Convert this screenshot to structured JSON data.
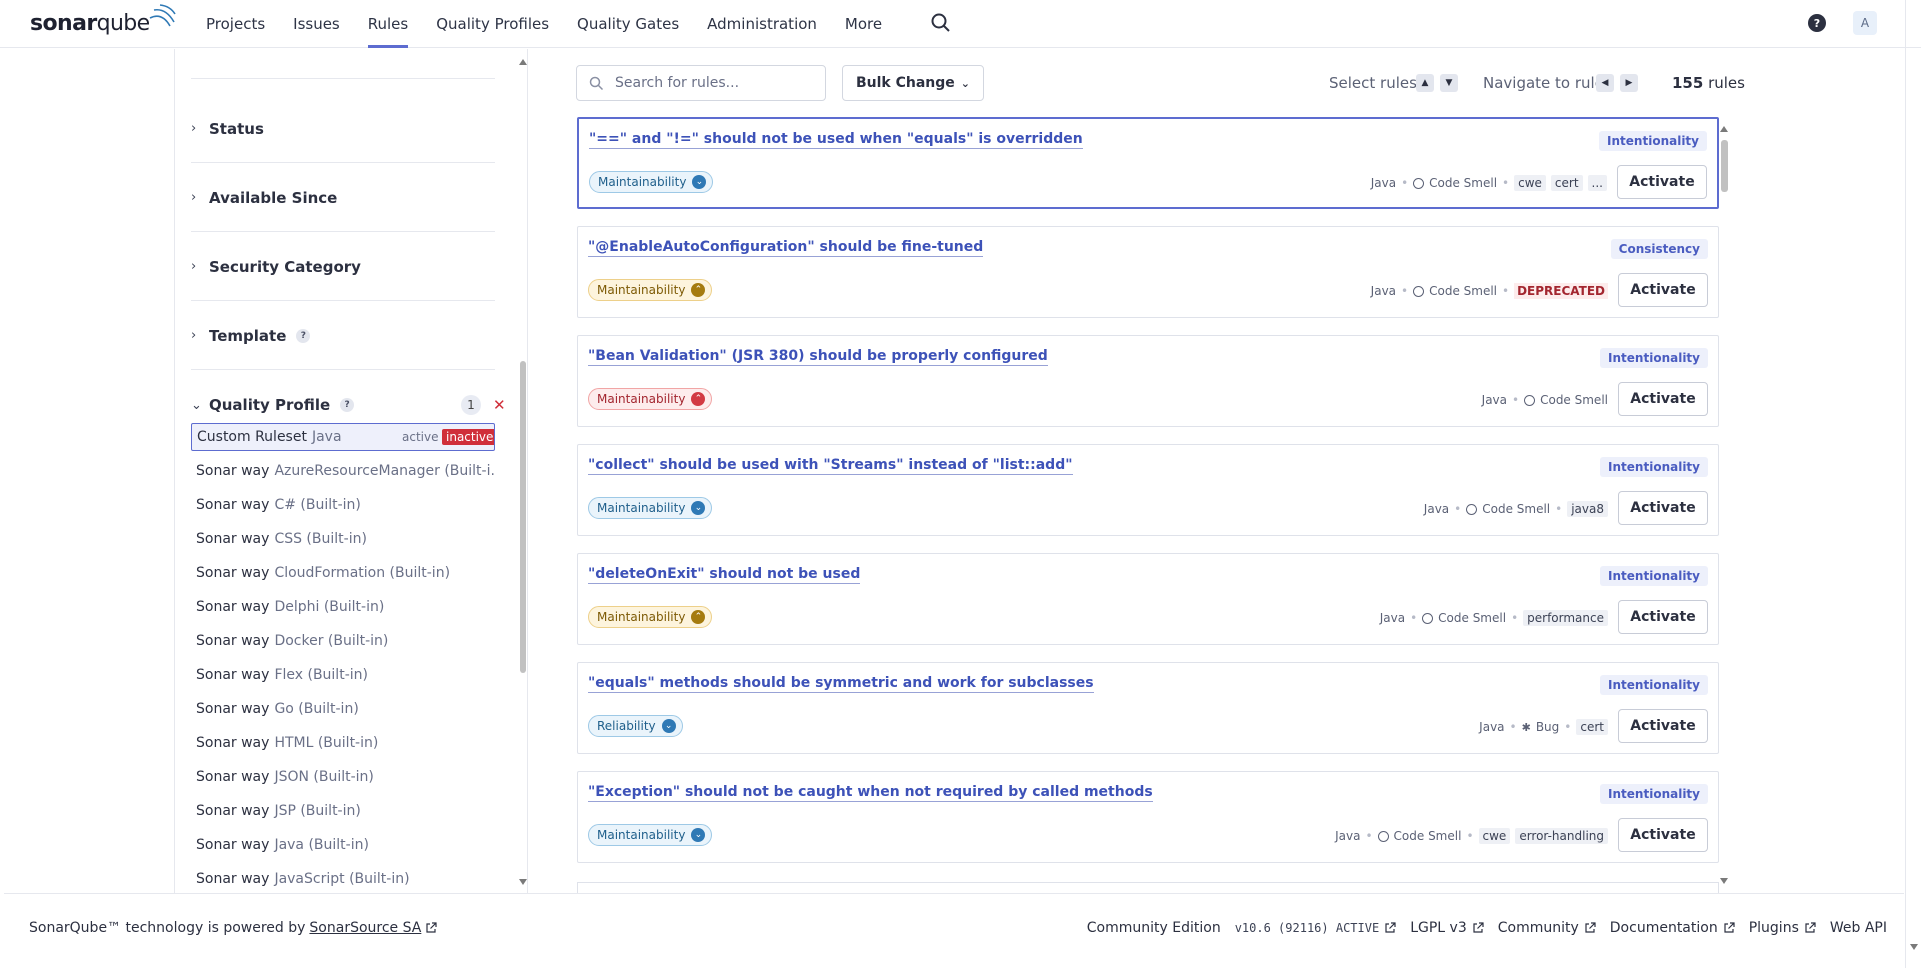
{
  "app": {
    "logo_bold": "sonar",
    "logo_light": "qube"
  },
  "nav": {
    "items": [
      "Projects",
      "Issues",
      "Rules",
      "Quality Profiles",
      "Quality Gates",
      "Administration",
      "More"
    ],
    "active": "Rules",
    "help": "?",
    "avatar": "A"
  },
  "sidebar": {
    "facets": [
      "Status",
      "Available Since",
      "Security Category",
      "Template",
      "Quality Profile"
    ],
    "template_help": "?",
    "quality_profile_help": "?",
    "quality_profile_count": "1",
    "profiles": [
      {
        "name": "Custom Ruleset",
        "lang": "Java",
        "active": "active",
        "inactive": "inactive"
      },
      {
        "name": "Sonar way",
        "lang": "AzureResourceManager (Built-i..."
      },
      {
        "name": "Sonar way",
        "lang": "C# (Built-in)"
      },
      {
        "name": "Sonar way",
        "lang": "CSS (Built-in)"
      },
      {
        "name": "Sonar way",
        "lang": "CloudFormation (Built-in)"
      },
      {
        "name": "Sonar way",
        "lang": "Delphi (Built-in)"
      },
      {
        "name": "Sonar way",
        "lang": "Docker (Built-in)"
      },
      {
        "name": "Sonar way",
        "lang": "Flex (Built-in)"
      },
      {
        "name": "Sonar way",
        "lang": "Go (Built-in)"
      },
      {
        "name": "Sonar way",
        "lang": "HTML (Built-in)"
      },
      {
        "name": "Sonar way",
        "lang": "JSON (Built-in)"
      },
      {
        "name": "Sonar way",
        "lang": "JSP (Built-in)"
      },
      {
        "name": "Sonar way",
        "lang": "Java (Built-in)"
      },
      {
        "name": "Sonar way",
        "lang": "JavaScript (Built-in)"
      }
    ]
  },
  "toolbar": {
    "search_placeholder": "Search for rules...",
    "bulk_change": "Bulk Change",
    "select_rules": "Select rules",
    "navigate_to_rule": "Navigate to rule",
    "total_count": "155",
    "total_suffix": "rules"
  },
  "rules": [
    {
      "title": "\"==\" and \"!=\" should not be used when \"equals\" is overridden",
      "attribute": "Intentionality",
      "impact": "Maintainability",
      "severity": "blue",
      "lang": "Java",
      "type": "Code Smell",
      "tags": [
        "cwe",
        "cert",
        "..."
      ],
      "deprecated": "",
      "action": "Activate"
    },
    {
      "title": "\"@EnableAutoConfiguration\" should be fine-tuned",
      "attribute": "Consistency",
      "impact": "Maintainability",
      "severity": "yellow",
      "lang": "Java",
      "type": "Code Smell",
      "tags": [],
      "deprecated": "DEPRECATED",
      "action": "Activate"
    },
    {
      "title": "\"Bean Validation\" (JSR 380) should be properly configured",
      "attribute": "Intentionality",
      "impact": "Maintainability",
      "severity": "red",
      "lang": "Java",
      "type": "Code Smell",
      "tags": [],
      "deprecated": "",
      "action": "Activate"
    },
    {
      "title": "\"collect\" should be used with \"Streams\" instead of \"list::add\"",
      "attribute": "Intentionality",
      "impact": "Maintainability",
      "severity": "blue",
      "lang": "Java",
      "type": "Code Smell",
      "tags": [
        "java8"
      ],
      "deprecated": "",
      "action": "Activate"
    },
    {
      "title": "\"deleteOnExit\" should not be used",
      "attribute": "Intentionality",
      "impact": "Maintainability",
      "severity": "yellow",
      "lang": "Java",
      "type": "Code Smell",
      "tags": [
        "performance"
      ],
      "deprecated": "",
      "action": "Activate"
    },
    {
      "title": "\"equals\" methods should be symmetric and work for subclasses",
      "attribute": "Intentionality",
      "impact": "Reliability",
      "severity": "blue",
      "lang": "Java",
      "type": "Bug",
      "tags": [
        "cert"
      ],
      "deprecated": "",
      "action": "Activate"
    },
    {
      "title": "\"Exception\" should not be caught when not required by called methods",
      "attribute": "Intentionality",
      "impact": "Maintainability",
      "severity": "blue",
      "lang": "Java",
      "type": "Code Smell",
      "tags": [
        "cwe",
        "error-handling"
      ],
      "deprecated": "",
      "action": "Activate"
    }
  ],
  "footer": {
    "powered_prefix": "SonarQube™ technology is powered by",
    "powered_link": "SonarSource SA",
    "edition": "Community Edition",
    "version": "v10.6 (92116) ACTIVE",
    "license": "LGPL v3",
    "community": "Community",
    "documentation": "Documentation",
    "plugins": "Plugins",
    "web_api": "Web API"
  },
  "colors": {
    "accent": "#5d6cd0",
    "danger": "#d02f3a",
    "link": "#3d52b8"
  }
}
